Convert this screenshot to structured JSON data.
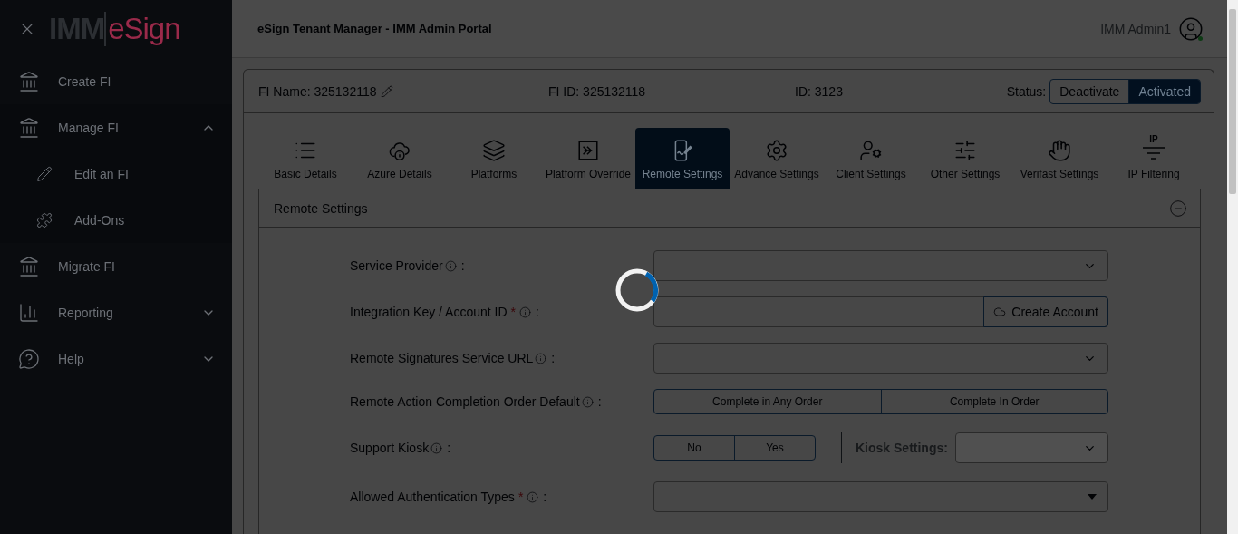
{
  "sidebar": {
    "logo": {
      "prefix": "IMM",
      "suffix": "eSign"
    },
    "items": [
      {
        "label": "Create FI"
      },
      {
        "label": "Manage FI",
        "expanded": true,
        "children": [
          {
            "label": "Edit an FI"
          },
          {
            "label": "Add-Ons"
          }
        ]
      },
      {
        "label": "Migrate FI"
      },
      {
        "label": "Reporting",
        "expanded": false
      },
      {
        "label": "Help",
        "expanded": false
      }
    ]
  },
  "header": {
    "title": "eSign Tenant Manager - IMM Admin Portal",
    "user": "IMM Admin1"
  },
  "fi_bar": {
    "name": "FI Name: 325132118",
    "fi_id": "FI ID: 325132118",
    "id": "ID: 3123",
    "status_label": "Status:",
    "status_options": [
      {
        "label": "Deactivate",
        "selected": false
      },
      {
        "label": "Activated",
        "selected": true
      }
    ]
  },
  "tabs": [
    {
      "label": "Basic Details",
      "selected": false
    },
    {
      "label": "Azure Details",
      "selected": false
    },
    {
      "label": "Platforms",
      "selected": false
    },
    {
      "label": "Platform Override",
      "selected": false
    },
    {
      "label": "Remote Settings",
      "selected": true
    },
    {
      "label": "Advance Settings",
      "selected": false
    },
    {
      "label": "Client Settings",
      "selected": false
    },
    {
      "label": "Other Settings",
      "selected": false
    },
    {
      "label": "Verifast Settings",
      "selected": false
    },
    {
      "label": "IP Filtering",
      "selected": false,
      "icon_text": "IP"
    }
  ],
  "section": {
    "title": "Remote Settings",
    "expanded": true
  },
  "fields": [
    {
      "kind": "select",
      "label": "Service Provider",
      "separator": ":"
    },
    {
      "kind": "input_button",
      "label": "Integration Key / Account ID",
      "required_mark": "*",
      "separator": ":",
      "button": "Create Account"
    },
    {
      "kind": "select",
      "label": "Remote Signatures Service URL",
      "separator": ":"
    },
    {
      "kind": "toggle",
      "label": "Remote Action Completion Order Default",
      "separator": ":",
      "options": [
        {
          "label": "Complete in Any Order",
          "selected": false
        },
        {
          "label": "Complete In Order",
          "selected": false
        }
      ]
    },
    {
      "kind": "kiosk",
      "label": "Support Kiosk",
      "separator": ":",
      "options": [
        {
          "label": "No",
          "selected": false
        },
        {
          "label": "Yes",
          "selected": false
        }
      ],
      "sub_label": "Kiosk Settings:"
    },
    {
      "kind": "multiselect",
      "label": "Allowed Authentication Types",
      "required_mark": "*",
      "separator": ":"
    }
  ],
  "loading": true
}
